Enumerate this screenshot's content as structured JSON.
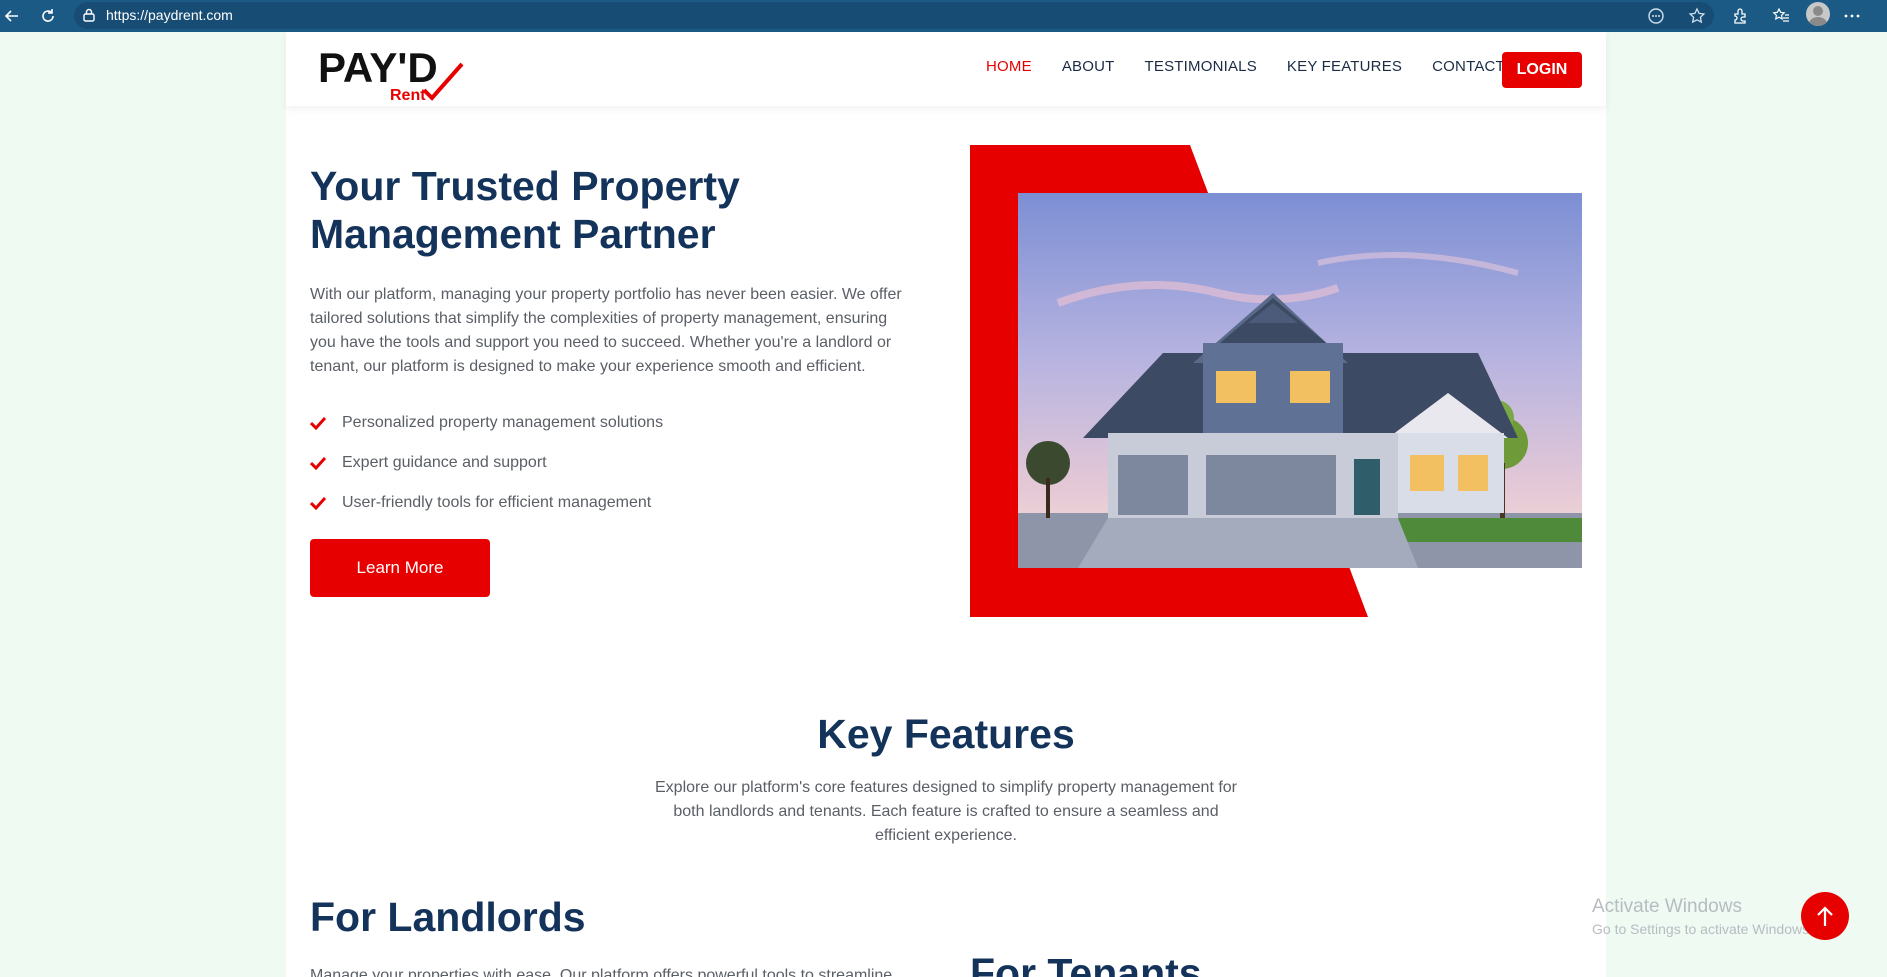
{
  "browser": {
    "url": "https://paydrent.com"
  },
  "logo": {
    "text_main": "PAY'D",
    "text_sub": "Rent"
  },
  "nav": {
    "items": [
      "HOME",
      "ABOUT",
      "TESTIMONIALS",
      "KEY FEATURES",
      "CONTACT"
    ],
    "active": "HOME",
    "login_label": "LOGIN"
  },
  "hero": {
    "title_line1": "Your Trusted Property",
    "title_line2": "Management Partner",
    "text": "With our platform, managing your property portfolio has never been easier. We offer tailored solutions that simplify the complexities of property management, ensuring you have the tools and support you need to succeed. Whether you're a landlord or tenant, our platform is designed to make your experience smooth and efficient.",
    "bullets": [
      "Personalized property management solutions",
      "Expert guidance and support",
      "User-friendly tools for efficient management"
    ],
    "cta_label": "Learn More"
  },
  "features": {
    "title": "Key Features",
    "text": "Explore our platform's core features designed to simplify property management for both landlords and tenants. Each feature is crafted to ensure a seamless and efficient experience.",
    "landlords_title": "For Landlords",
    "landlords_text": "Manage your properties with ease. Our platform offers powerful tools to streamline",
    "tenants_title": "For Tenants"
  },
  "overlay": {
    "activate_title": "Activate Windows",
    "activate_sub": "Go to Settings to activate Windows."
  },
  "colors": {
    "brand_red": "#e60000",
    "navy": "#14335a",
    "browser_bar": "#1c5a86",
    "page_bg": "#eefaf2"
  },
  "icons": [
    "back-arrow-icon",
    "refresh-icon",
    "lock-icon",
    "reader-icon",
    "star-icon",
    "extensions-icon",
    "favorites-icon",
    "profile-icon",
    "more-icon",
    "check-icon",
    "arrow-up-icon"
  ]
}
